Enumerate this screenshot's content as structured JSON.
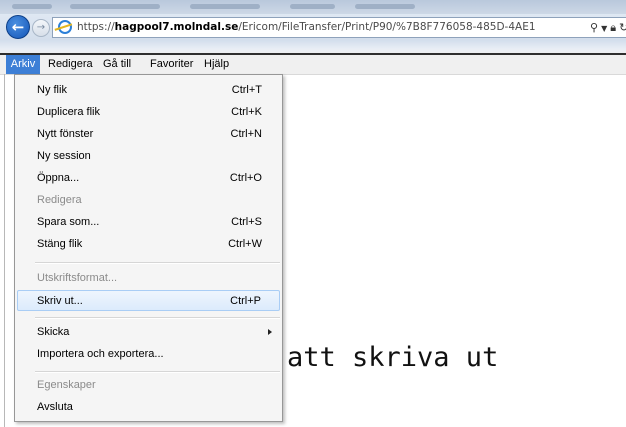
{
  "address_bar": {
    "url_prefix": "https://",
    "url_domain": "hagpool7.molndal.se",
    "url_rest": "/Ericom/FileTransfer/Print/P90/%7B8F776058-485D-4AE1",
    "search_icon": "search-icon",
    "dropdown_icon": "chevron-down-icon",
    "lock_icon": "lock-icon",
    "refresh_icon": "refresh-icon"
  },
  "menubar": {
    "items": [
      "Arkiv",
      "Redigera",
      "Gå till",
      "Favoriter",
      "Hjälp"
    ],
    "active": "Arkiv",
    "active_color": "#3d7fd6"
  },
  "menu": {
    "items": [
      {
        "label": "Ny flik",
        "shortcut": "Ctrl+T"
      },
      {
        "label": "Duplicera flik",
        "shortcut": "Ctrl+K"
      },
      {
        "label": "Nytt fönster",
        "shortcut": "Ctrl+N"
      },
      {
        "label": "Ny session",
        "shortcut": ""
      },
      {
        "label": "Öppna...",
        "shortcut": "Ctrl+O"
      },
      {
        "label": "Redigera",
        "shortcut": "",
        "disabled": true
      },
      {
        "label": "Spara som...",
        "shortcut": "Ctrl+S"
      },
      {
        "label": "Stäng flik",
        "shortcut": "Ctrl+W"
      },
      {
        "label": "Utskriftsformat...",
        "shortcut": "",
        "disabled": true
      },
      {
        "label": "Skriv ut...",
        "shortcut": "Ctrl+P",
        "highlighted": true
      },
      {
        "label": "Skicka",
        "shortcut": "",
        "submenu": true
      },
      {
        "label": "Importera och exportera...",
        "shortcut": ""
      },
      {
        "label": "Egenskaper",
        "shortcut": "",
        "disabled": true
      },
      {
        "label": "Avsluta",
        "shortcut": ""
      }
    ]
  },
  "page": {
    "visible_text": "att skriva ut"
  }
}
